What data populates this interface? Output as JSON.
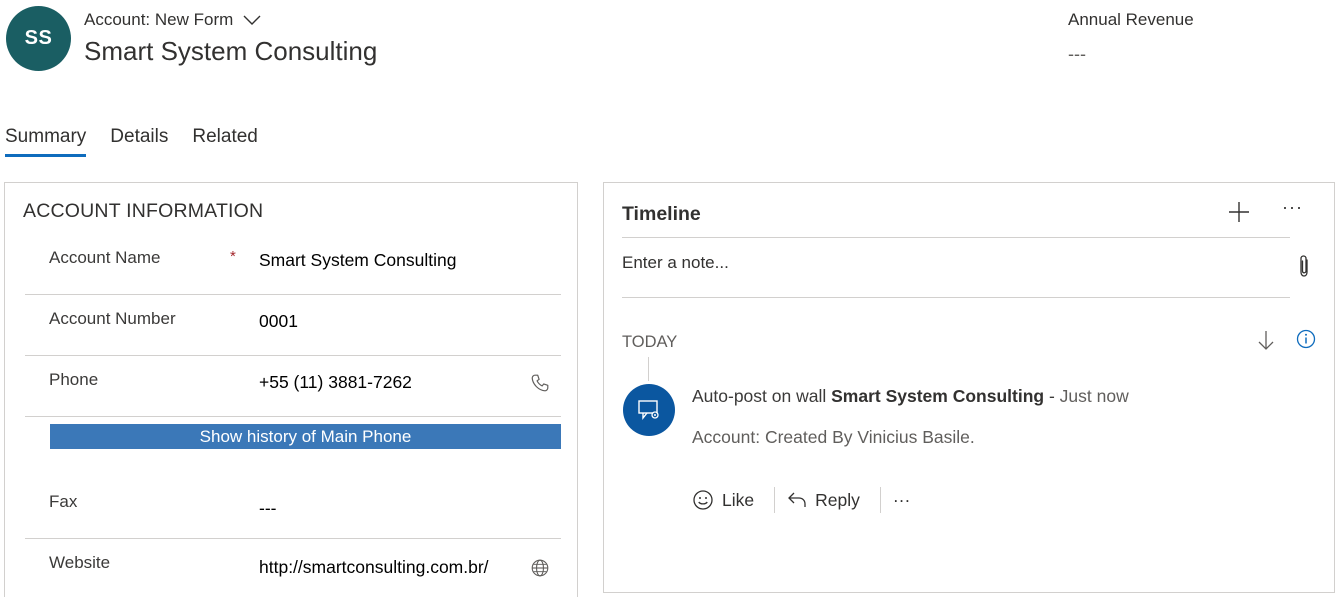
{
  "header": {
    "avatar_initials": "SS",
    "form_label": "Account: New Form",
    "record_title": "Smart System Consulting",
    "annual_revenue_label": "Annual Revenue",
    "annual_revenue_value": "---"
  },
  "tabs": [
    {
      "label": "Summary",
      "active": true
    },
    {
      "label": "Details",
      "active": false
    },
    {
      "label": "Related",
      "active": false
    }
  ],
  "account_info": {
    "section_title": "ACCOUNT INFORMATION",
    "fields": [
      {
        "label": "Account Name",
        "required_mark": "*",
        "value": "Smart System Consulting"
      },
      {
        "label": "Account Number",
        "value": "0001"
      },
      {
        "label": "Phone",
        "value": "+55 (11) 3881-7262",
        "icon": "phone-icon"
      },
      {
        "label": "Fax",
        "value": "---"
      },
      {
        "label": "Website",
        "value": "http://smartconsulting.com.br/",
        "icon": "globe-icon"
      }
    ],
    "history_button_label": "Show history of Main Phone"
  },
  "timeline": {
    "title": "Timeline",
    "more_label": "···",
    "note_placeholder": "Enter a note...",
    "group_label": "TODAY",
    "post": {
      "prefix": "Auto-post on wall",
      "subject": "Smart System Consulting",
      "separator": "-",
      "when": "Just now",
      "body": "Account: Created By Vinicius Basile."
    },
    "actions": {
      "like_label": "Like",
      "reply_label": "Reply",
      "more_label": "···"
    }
  },
  "colors": {
    "avatar_bg": "#1a5e63",
    "accent": "#0f6cbd",
    "history_button_bg": "#3b78b8",
    "post_avatar_bg": "#0b57a0"
  }
}
